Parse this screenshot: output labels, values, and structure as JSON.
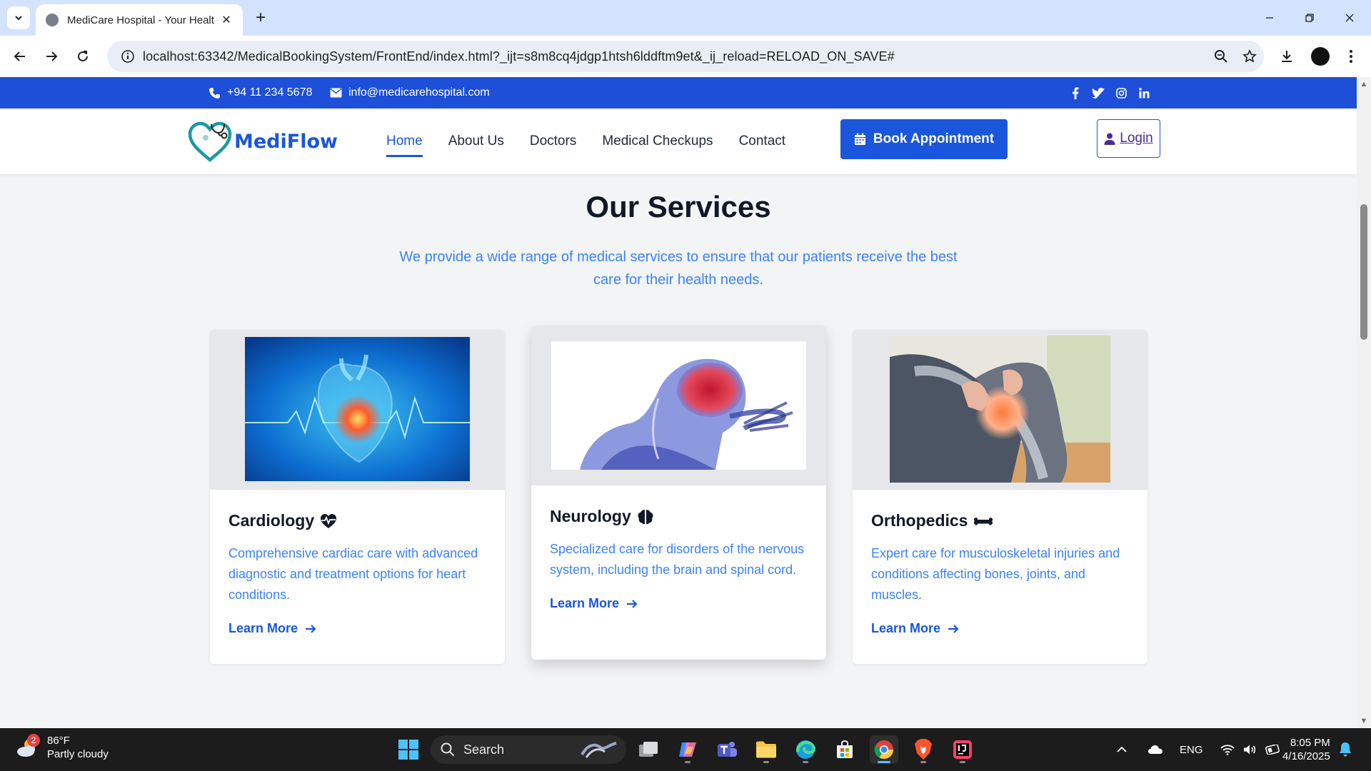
{
  "browser": {
    "tab_title": "MediCare Hospital - Your Healt",
    "url": "localhost:63342/MedicalBookingSystem/FrontEnd/index.html?_ijt=s8m8cq4jdgp1htsh6lddftm9et&_ij_reload=RELOAD_ON_SAVE#"
  },
  "topbar": {
    "phone": "+94 11 234 5678",
    "email": "info@medicarehospital.com",
    "social": [
      "facebook-icon",
      "twitter-icon",
      "instagram-icon",
      "linkedin-icon"
    ]
  },
  "nav": {
    "logo_text": "MediFlow",
    "links": [
      "Home",
      "About Us",
      "Doctors",
      "Medical Checkups",
      "Contact"
    ],
    "active": "Home",
    "book_label": "Book Appointment",
    "login_label": "Login"
  },
  "services": {
    "title": "Our Services",
    "subtitle": "We provide a wide range of medical services to ensure that our patients receive the best care for their health needs.",
    "cards": [
      {
        "title": "Cardiology",
        "icon": "heartbeat-icon",
        "description": "Comprehensive cardiac care with advanced diagnostic and treatment options for heart conditions.",
        "link": "Learn More"
      },
      {
        "title": "Neurology",
        "icon": "brain-icon",
        "description": "Specialized care for disorders of the nervous system, including the brain and spinal cord.",
        "link": "Learn More"
      },
      {
        "title": "Orthopedics",
        "icon": "bone-icon",
        "description": "Expert care for musculoskeletal injuries and conditions affecting bones, joints, and muscles.",
        "link": "Learn More"
      }
    ]
  },
  "taskbar": {
    "weather_temp": "86°F",
    "weather_desc": "Partly cloudy",
    "weather_badge": "2",
    "search_label": "Search",
    "language": "ENG",
    "time": "8:05 PM",
    "date": "4/16/2025"
  },
  "colors": {
    "brand": "#1a56db",
    "topbar": "#1d4fd8",
    "accent_text": "#3b82f6"
  }
}
